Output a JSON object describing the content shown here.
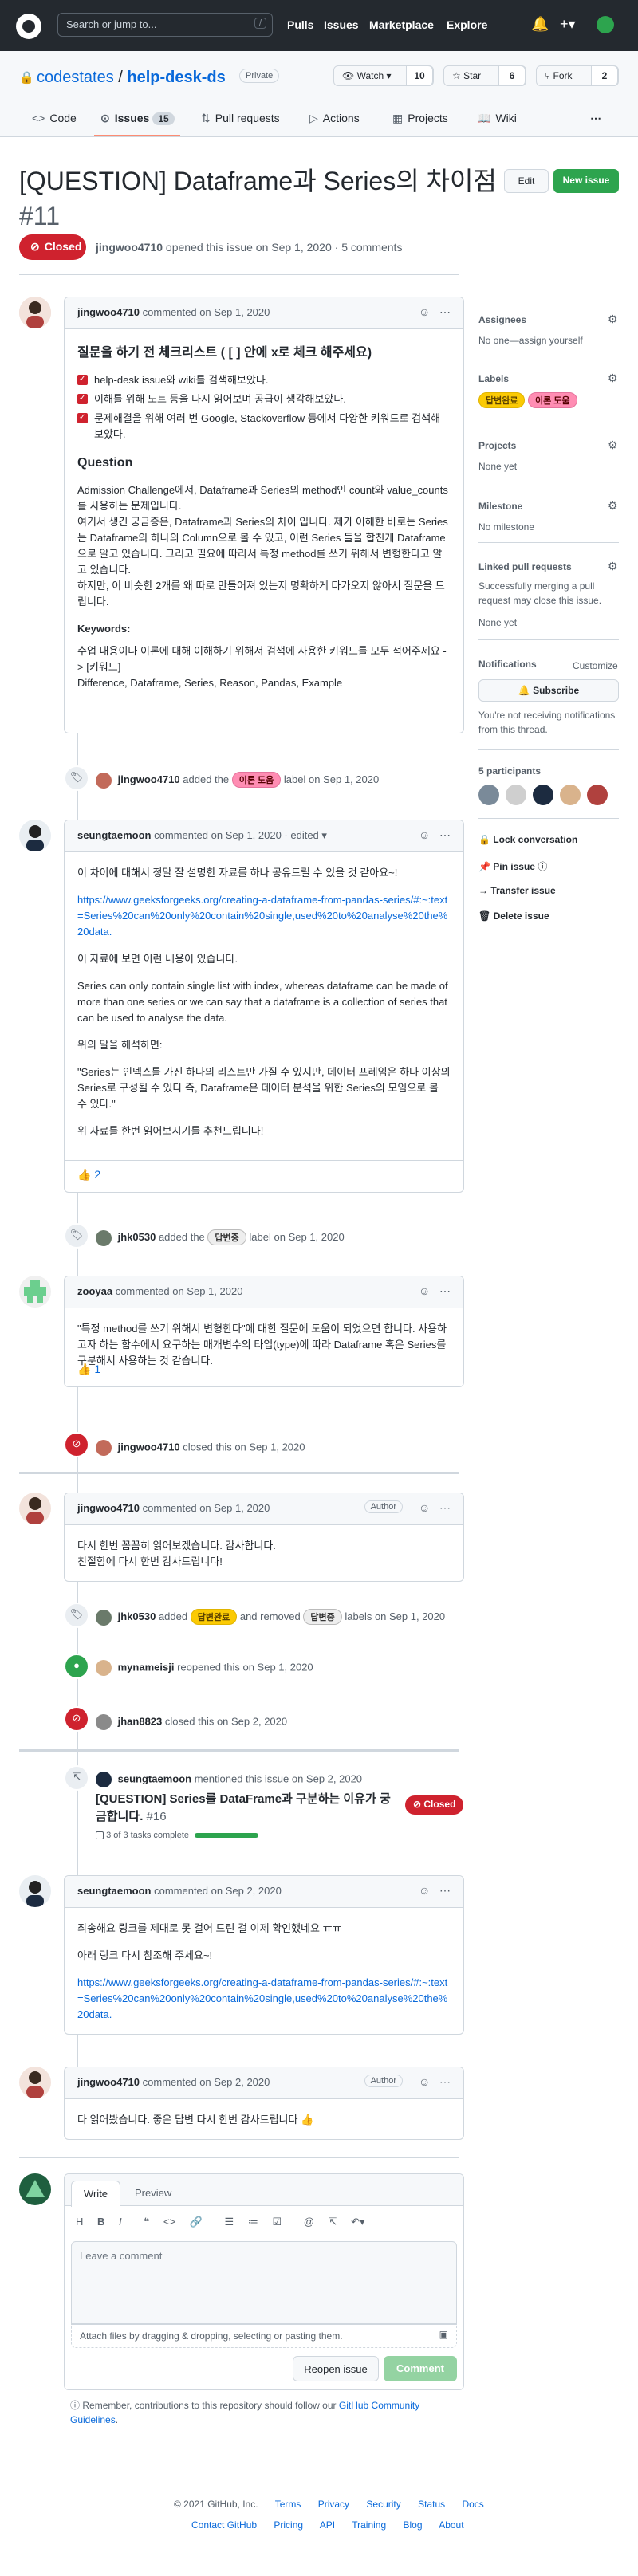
{
  "header": {
    "search_placeholder": "Search or jump to...",
    "search_shortcut": "/",
    "nav": [
      "Pulls",
      "Issues",
      "Marketplace",
      "Explore"
    ]
  },
  "repo": {
    "owner": "codestates",
    "name": "help-desk-ds",
    "visibility": "Private",
    "watch_label": "Watch",
    "watch_count": "10",
    "star_label": "Star",
    "star_count": "6",
    "fork_label": "Fork",
    "fork_count": "2"
  },
  "tabs": {
    "code": "Code",
    "issues": "Issues",
    "issues_count": "15",
    "pulls": "Pull requests",
    "actions": "Actions",
    "projects": "Projects",
    "wiki": "Wiki"
  },
  "issue": {
    "title": "[QUESTION] Dataframe과 Series의 차이점",
    "number": "#11",
    "edit_label": "Edit",
    "new_issue_label": "New issue",
    "state": "Closed",
    "author": "jingwoo4710",
    "meta_rest": "opened this issue on Sep 1, 2020 · 5 comments"
  },
  "comment1": {
    "author": "jingwoo4710",
    "date": "commented on Sep 1, 2020",
    "heading": "질문을 하기 전 체크리스트 ( [ ] 안에 x로 체크 해주세요)",
    "checks": [
      "help-desk issue와 wiki를 검색해보았다.",
      "이해를 위해 노트 등을 다시 읽어보며 공급이 생각해보았다.",
      "문제해결을 위해 여러 번 Google, Stackoverflow 등에서 다양한 키워드로 검색해 보았다."
    ],
    "question_heading": "Question",
    "question_p1": "Admission Challenge에서, Dataframe과 Series의 method인 count와 value_counts를 사용하는 문제입니다.",
    "question_p2": "여기서 생긴 궁금증은, Dataframe과 Series의 차이 입니다. 제가 이해한 바로는 Series는 Dataframe의 하나의 Column으로 볼 수 있고, 이런 Series 들을 합친게 Dataframe으로 알고 있습니다. 그리고 필요에 따라서 특정 method를 쓰기 위해서 변형한다고 알고 있습니다.",
    "question_p3": "하지만, 이 비슷한 2개를 왜 따로 만들어져 있는지 명확하게 다가오지 않아서 질문을 드립니다.",
    "keywords_heading": "Keywords:",
    "keywords_p1": "수업 내용이나 이론에 대해 이해하기 위해서 검색에 사용한 키워드를 모두 적어주세요 -> [키워드]",
    "keywords_p2": "Difference, Dataframe, Series, Reason, Pandas, Example"
  },
  "event_label1": {
    "user": "jingwoo4710",
    "added": "added the",
    "label": "이론 도움",
    "rest": "label on Sep 1, 2020"
  },
  "comment2": {
    "author": "seungtaemoon",
    "date": "commented on Sep 1, 2020 · edited",
    "p1": "이 차이에 대해서 정말 잘 설명한 자료를 하나 공유드릴 수 있을 것 같아요~!",
    "link": "https://www.geeksforgeeks.org/creating-a-dataframe-from-pandas-series/#:~:text=Series%20can%20only%20contain%20single,used%20to%20analyse%20the%20data.",
    "p2": "이 자료에 보면 이런 내용이 있습니다.",
    "p3": "Series can only contain single list with index, whereas dataframe can be made of more than one series or we can say that a dataframe is a collection of series that can be used to analyse the data.",
    "p4": "위의 말을 해석하면:",
    "p5": "\"Series는 인덱스를 가진 하나의 리스트만 가질 수 있지만, 데이터 프레임은 하나 이상의 Series로 구성될 수 있다 즉, Dataframe은 데이터 분석을 위한 Series의 모임으로 볼 수 있다.\"",
    "p6": "위 자료를 한번 읽어보시기를 추천드립니다!",
    "reaction": "👍",
    "reaction_count": "2"
  },
  "event_label2": {
    "user": "jhk0530",
    "added": "added the",
    "label": "답변중",
    "rest": "label on Sep 1, 2020"
  },
  "comment3": {
    "author": "zooyaa",
    "date": "commented on Sep 1, 2020",
    "p1": "\"특정 method를 쓰기 위해서 변형한다\"에 대한 질문에 도움이 되었으면 합니다. 사용하고자 하는 함수에서 요구하는 매개변수의 타입(type)에 따라 Dataframe 혹은 Series를 구분해서 사용하는 것 같습니다.",
    "reaction": "👍",
    "reaction_count": "1"
  },
  "event_closed1": {
    "user": "jingwoo4710",
    "rest": "closed this on Sep 1, 2020"
  },
  "comment4": {
    "author": "jingwoo4710",
    "date": "commented on Sep 1, 2020",
    "badge": "Author",
    "p1": "다시 한번 꼼꼼히 읽어보겠습니다. 감사합니다.",
    "p2": "친절함에 다시 한번 감사드립니다!"
  },
  "event_labels": {
    "user": "jhk0530",
    "added": "added",
    "label1": "답변완료",
    "removed": "and removed",
    "label2": "답변중",
    "rest": "labels on Sep 1, 2020"
  },
  "event_reopen": {
    "user": "mynameisji",
    "rest": "reopened this on Sep 1, 2020"
  },
  "event_closed2": {
    "user": "jhan8823",
    "rest": "closed this on Sep 2, 2020"
  },
  "event_mention": {
    "user": "seungtaemoon",
    "rest": "mentioned this issue on Sep 2, 2020",
    "ref_title": "[QUESTION] Series를 DataFrame과 구분하는 이유가 궁금합니다.",
    "ref_number": "#16",
    "ref_state": "Closed",
    "tasks": "3 of 3 tasks complete"
  },
  "comment5": {
    "author": "seungtaemoon",
    "date": "commented on Sep 2, 2020",
    "p1": "죄송해요 링크를 제대로 못 걸어 드린 걸 이제 확인했네요 ㅠㅠ",
    "p2": "아래 링크 다시 참조해 주세요~!",
    "link": "https://www.geeksforgeeks.org/creating-a-dataframe-from-pandas-series/#:~:text=Series%20can%20only%20contain%20single,used%20to%20analyse%20the%20data."
  },
  "comment6": {
    "author": "jingwoo4710",
    "date": "commented on Sep 2, 2020",
    "badge": "Author",
    "p1": "다 읽어봤습니다. 좋은 답변 다시 한번 감사드립니다 👍"
  },
  "editor": {
    "tab_write": "Write",
    "tab_preview": "Preview",
    "placeholder": "Leave a comment",
    "attach": "Attach files by dragging & dropping, selecting or pasting them.",
    "reopen": "Reopen issue",
    "submit": "Comment",
    "remember": "Remember, contributions to this repository should follow our",
    "guidelines": "GitHub Community Guidelines",
    "period": "."
  },
  "sidebar": {
    "assignees": "Assignees",
    "assignees_value": "No one—assign yourself",
    "labels": "Labels",
    "label1": "답변완료",
    "label2": "이론 도움",
    "projects": "Projects",
    "projects_value": "None yet",
    "milestone": "Milestone",
    "milestone_value": "No milestone",
    "linked": "Linked pull requests",
    "linked_text": "Successfully merging a pull request may close this issue.",
    "linked_value": "None yet",
    "notifications": "Notifications",
    "customize": "Customize",
    "subscribe": "Subscribe",
    "notif_text": "You're not receiving notifications from this thread.",
    "participants": "5 participants",
    "lock": "Lock conversation",
    "pin": "Pin issue",
    "transfer": "Transfer issue",
    "delete": "Delete issue"
  },
  "footer": {
    "copyright": "© 2021 GitHub, Inc.",
    "links1": [
      "Terms",
      "Privacy",
      "Security",
      "Status",
      "Docs"
    ],
    "links2": [
      "Contact GitHub",
      "Pricing",
      "API",
      "Training",
      "Blog",
      "About"
    ]
  },
  "colors": {
    "closed": "#cf222e",
    "open": "#2da44e",
    "link": "#0969da"
  }
}
